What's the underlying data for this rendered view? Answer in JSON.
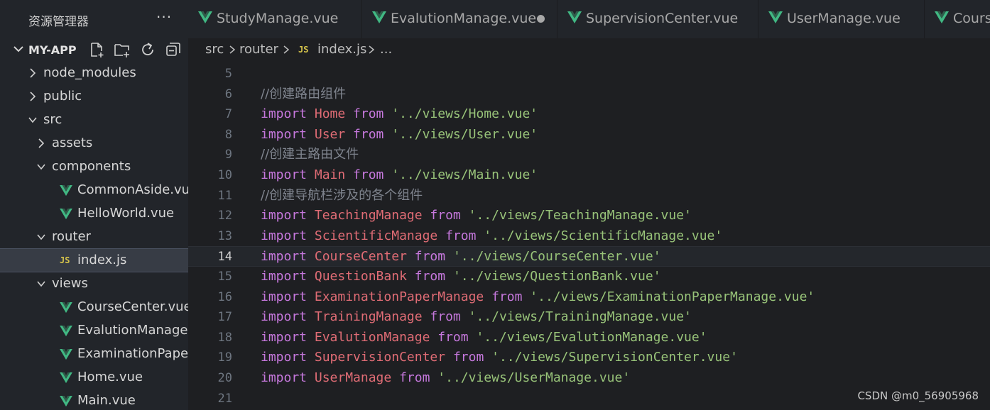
{
  "explorer": {
    "title": "资源管理器",
    "more": "···",
    "project": "MY-APP",
    "actions": [
      "new-file-icon",
      "new-folder-icon",
      "refresh-icon",
      "collapse-all-icon"
    ]
  },
  "tree": [
    {
      "label": "node_modules",
      "type": "folder",
      "open": false,
      "depth": 0
    },
    {
      "label": "public",
      "type": "folder",
      "open": false,
      "depth": 0
    },
    {
      "label": "src",
      "type": "folder",
      "open": true,
      "depth": 0
    },
    {
      "label": "assets",
      "type": "folder",
      "open": false,
      "depth": 1
    },
    {
      "label": "components",
      "type": "folder",
      "open": true,
      "depth": 1
    },
    {
      "label": "CommonAside.vue",
      "type": "vue",
      "depth": 2
    },
    {
      "label": "HelloWorld.vue",
      "type": "vue",
      "depth": 2
    },
    {
      "label": "router",
      "type": "folder",
      "open": true,
      "depth": 1
    },
    {
      "label": "index.js",
      "type": "js",
      "depth": 2,
      "selected": true
    },
    {
      "label": "views",
      "type": "folder",
      "open": true,
      "depth": 1
    },
    {
      "label": "CourseCenter.vue",
      "type": "vue",
      "depth": 2
    },
    {
      "label": "EvalutionManage.v...",
      "type": "vue",
      "depth": 2
    },
    {
      "label": "ExaminationPaper...",
      "type": "vue",
      "depth": 2
    },
    {
      "label": "Home.vue",
      "type": "vue",
      "depth": 2
    },
    {
      "label": "Main.vue",
      "type": "vue",
      "depth": 2
    }
  ],
  "tabs": [
    {
      "label": "StudyManage.vue",
      "dirty": false
    },
    {
      "label": "EvalutionManage.vue",
      "dirty": true
    },
    {
      "label": "SupervisionCenter.vue",
      "dirty": false
    },
    {
      "label": "UserManage.vue",
      "dirty": false
    },
    {
      "label": "Course",
      "dirty": false
    }
  ],
  "breadcrumb": {
    "parts": [
      "src",
      "router",
      "index.js",
      "..."
    ],
    "file_badge": "JS"
  },
  "editor": {
    "current_line": 14,
    "lines": [
      {
        "n": "5",
        "tokens": []
      },
      {
        "n": "6",
        "tokens": [
          {
            "t": "//创建路由组件",
            "c": "cm"
          }
        ]
      },
      {
        "n": "7",
        "tokens": [
          {
            "t": "import ",
            "c": "kw"
          },
          {
            "t": "Home ",
            "c": "id"
          },
          {
            "t": "from ",
            "c": "kw"
          },
          {
            "t": "'../views/Home.vue'",
            "c": "str"
          }
        ]
      },
      {
        "n": "8",
        "tokens": [
          {
            "t": "import ",
            "c": "kw"
          },
          {
            "t": "User ",
            "c": "id"
          },
          {
            "t": "from ",
            "c": "kw"
          },
          {
            "t": "'../views/User.vue'",
            "c": "str"
          }
        ]
      },
      {
        "n": "9",
        "tokens": [
          {
            "t": "//创建主路由文件",
            "c": "cm"
          }
        ]
      },
      {
        "n": "10",
        "tokens": [
          {
            "t": "import ",
            "c": "kw"
          },
          {
            "t": "Main ",
            "c": "id"
          },
          {
            "t": "from ",
            "c": "kw"
          },
          {
            "t": "'../views/Main.vue'",
            "c": "str"
          }
        ]
      },
      {
        "n": "11",
        "tokens": [
          {
            "t": "//创建导航栏涉及的各个组件",
            "c": "cm"
          }
        ]
      },
      {
        "n": "12",
        "tokens": [
          {
            "t": "import ",
            "c": "kw"
          },
          {
            "t": "TeachingManage ",
            "c": "id"
          },
          {
            "t": "from ",
            "c": "kw"
          },
          {
            "t": "'../views/TeachingManage.vue'",
            "c": "str"
          }
        ]
      },
      {
        "n": "13",
        "tokens": [
          {
            "t": "import ",
            "c": "kw"
          },
          {
            "t": "ScientificManage ",
            "c": "id"
          },
          {
            "t": "from ",
            "c": "kw"
          },
          {
            "t": "'../views/ScientificManage.vue'",
            "c": "str"
          }
        ]
      },
      {
        "n": "14",
        "tokens": [
          {
            "t": "import ",
            "c": "kw"
          },
          {
            "t": "CourseCenter ",
            "c": "id"
          },
          {
            "t": "from ",
            "c": "kw"
          },
          {
            "t": "'../views/CourseCenter.vue'",
            "c": "str"
          }
        ]
      },
      {
        "n": "15",
        "tokens": [
          {
            "t": "import ",
            "c": "kw"
          },
          {
            "t": "QuestionBank ",
            "c": "id"
          },
          {
            "t": "from ",
            "c": "kw"
          },
          {
            "t": "'../views/QuestionBank.vue'",
            "c": "str"
          }
        ]
      },
      {
        "n": "16",
        "tokens": [
          {
            "t": "import ",
            "c": "kw"
          },
          {
            "t": "ExaminationPaperManage ",
            "c": "id"
          },
          {
            "t": "from ",
            "c": "kw"
          },
          {
            "t": "'../views/ExaminationPaperManage.vue'",
            "c": "str"
          }
        ]
      },
      {
        "n": "17",
        "tokens": [
          {
            "t": "import ",
            "c": "kw"
          },
          {
            "t": "TrainingManage ",
            "c": "id"
          },
          {
            "t": "from ",
            "c": "kw"
          },
          {
            "t": "'../views/TrainingManage.vue'",
            "c": "str"
          }
        ]
      },
      {
        "n": "18",
        "tokens": [
          {
            "t": "import ",
            "c": "kw"
          },
          {
            "t": "EvalutionManage ",
            "c": "id"
          },
          {
            "t": "from ",
            "c": "kw"
          },
          {
            "t": "'../views/EvalutionManage.vue'",
            "c": "str"
          }
        ]
      },
      {
        "n": "19",
        "tokens": [
          {
            "t": "import ",
            "c": "kw"
          },
          {
            "t": "SupervisionCenter ",
            "c": "id"
          },
          {
            "t": "from ",
            "c": "kw"
          },
          {
            "t": "'../views/SupervisionCenter.vue'",
            "c": "str"
          }
        ]
      },
      {
        "n": "20",
        "tokens": [
          {
            "t": "import ",
            "c": "kw"
          },
          {
            "t": "UserManage ",
            "c": "id"
          },
          {
            "t": "from ",
            "c": "kw"
          },
          {
            "t": "'../views/UserManage.vue'",
            "c": "str"
          }
        ]
      },
      {
        "n": "21",
        "tokens": []
      }
    ]
  },
  "watermark": "CSDN @m0_56905968",
  "colors": {
    "keyword": "#c678dd",
    "identifier": "#e06c75",
    "string": "#98c379",
    "comment": "#7f848e",
    "vue_icon": "#41b883",
    "js_badge": "#d6c44b"
  }
}
